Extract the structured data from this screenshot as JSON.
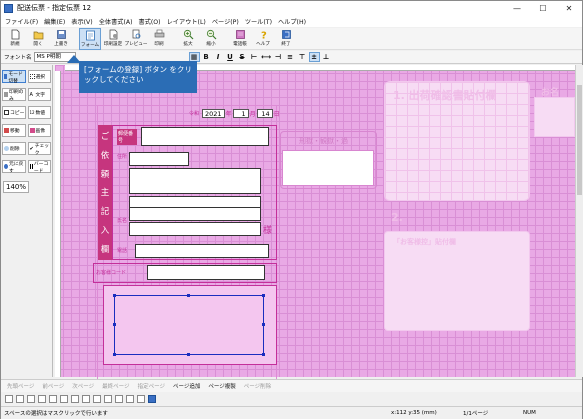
{
  "window": {
    "title": "配送伝票 - 指定伝票 12",
    "controls": [
      "—",
      "☐",
      "✕"
    ]
  },
  "menu": [
    "ファイル(F)",
    "編集(E)",
    "表示(V)",
    "全体書式(A)",
    "書式(O)",
    "レイアウト(L)",
    "ページ(P)",
    "ツール(T)",
    "ヘルプ(H)"
  ],
  "toolbar": {
    "buttons": [
      {
        "label": "新規",
        "icon": "new-file-icon"
      },
      {
        "label": "開く",
        "icon": "open-folder-icon"
      },
      {
        "label": "上書き",
        "icon": "save-icon"
      },
      {
        "label": "フォーム",
        "icon": "form-register-icon"
      },
      {
        "label": "印刷設定",
        "icon": "print-setup-icon"
      },
      {
        "label": "プレビュー",
        "icon": "preview-icon"
      },
      {
        "label": "印刷",
        "icon": "print-icon"
      },
      {
        "label": "拡大",
        "icon": "zoom-in-icon"
      },
      {
        "label": "縮小",
        "icon": "zoom-out-icon"
      },
      {
        "label": "電話帳",
        "icon": "phonebook-icon"
      },
      {
        "label": "ヘルプ",
        "icon": "help-icon"
      },
      {
        "label": "終了",
        "icon": "exit-icon"
      }
    ]
  },
  "format_bar": {
    "font_label": "フォント名",
    "font_value": "MS P明朝",
    "buttons": [
      "B",
      "I",
      "U",
      "S"
    ]
  },
  "palette": {
    "items": [
      [
        "モード切替",
        "選択"
      ],
      [
        "印刷のみ",
        "文字"
      ],
      [
        "コピー",
        "数値"
      ],
      [
        "移動",
        "画像"
      ],
      [
        "削除",
        "チェック"
      ],
      [
        "元に戻す",
        "バーコード"
      ]
    ],
    "zoom": "140%"
  },
  "tooltip": {
    "text": "[フォームの登録] ボタン をクリックしてください"
  },
  "form": {
    "date": {
      "year": "2021",
      "month": "1",
      "day": "14"
    },
    "labels": {
      "postal": "郵便番号",
      "address": "住所",
      "name": "氏名",
      "phone": "電話",
      "customer_code": "お客様コード",
      "sama": "様"
    },
    "vertical_title": [
      "ご",
      "依",
      "頼",
      "主",
      "記",
      "入",
      "欄"
    ],
    "right_box": "刑獄・観獄・過",
    "right_heading_1": "1. 出荷確認書貼付欄",
    "right_heading_2": "2.",
    "right_sub": "「お客様控」貼付欄",
    "right_corner": "お名"
  },
  "pagebar": {
    "items": [
      "先頭ページ",
      "前ページ",
      "次ページ",
      "最終ページ",
      "指定ページ",
      "ページ追加",
      "ページ複製",
      "ページ削除"
    ]
  },
  "status": {
    "message": "スペースの選択はマスクリックで行います",
    "coords": "x:112 y:35 (mm)",
    "page": "1/1ページ",
    "num": "NUM"
  }
}
